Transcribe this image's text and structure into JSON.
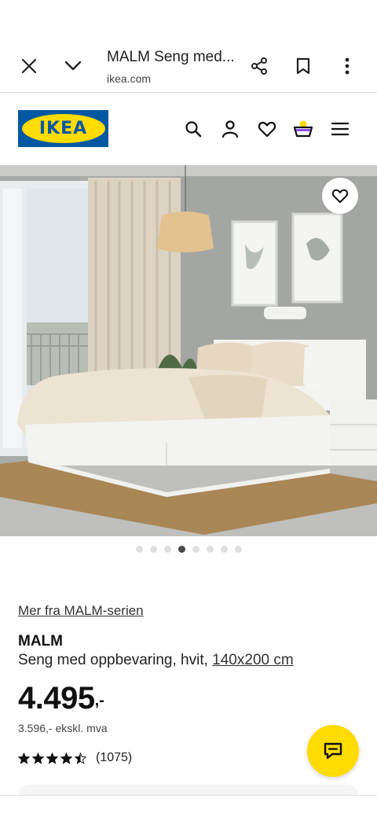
{
  "browser": {
    "title": "MALM Seng med...",
    "url": "ikea.com",
    "icons": [
      "close-icon",
      "chevron-down-icon",
      "share-icon",
      "bookmark-icon",
      "more-vert-icon"
    ]
  },
  "header": {
    "logo_text": "IKEA",
    "icons": [
      "search-icon",
      "user-icon",
      "heart-icon",
      "basket-icon",
      "menu-icon"
    ],
    "brand_colors": {
      "blue": "#0058a3",
      "yellow": "#ffdb00"
    }
  },
  "gallery": {
    "image_count": 8,
    "active_index": 3
  },
  "product": {
    "series_link": "Mer fra MALM-serien",
    "name": "MALM",
    "description": "Seng med oppbevaring, hvit,",
    "size_link": "140x200 cm",
    "price_integer": "4.495",
    "price_decimal": ",-",
    "price_ex_vat": "3.596,- ekskl. mva",
    "rating": 4.5,
    "review_count": "(1075)"
  },
  "chat": {
    "icon": "chat-icon",
    "color": "#ffdb00"
  }
}
